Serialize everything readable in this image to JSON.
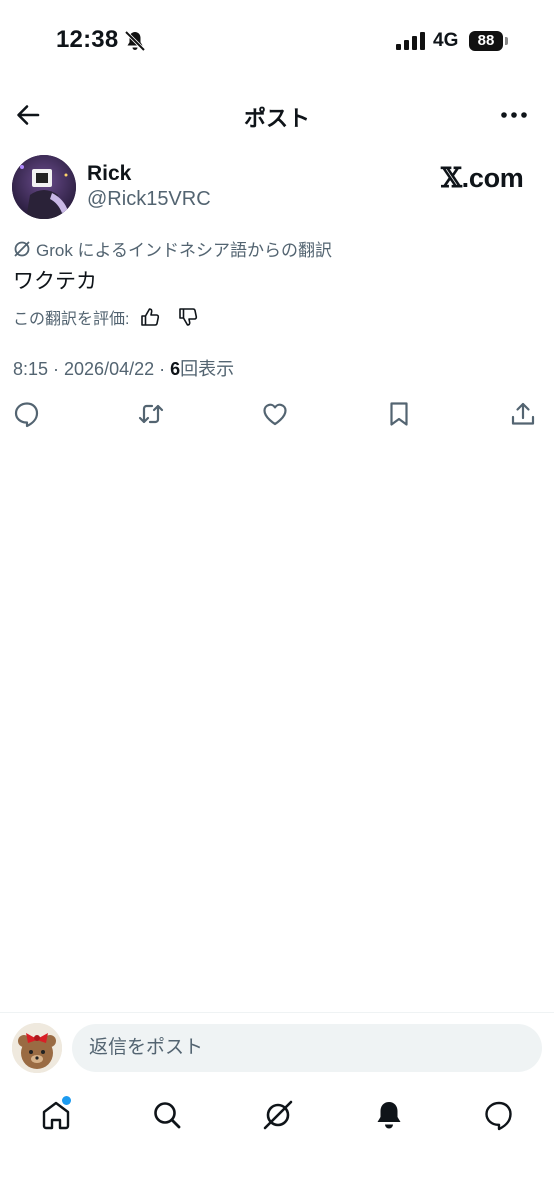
{
  "status_bar": {
    "time": "12:38",
    "network": "4G",
    "battery": "88"
  },
  "header": {
    "title": "ポスト"
  },
  "post": {
    "display_name": "Rick",
    "handle": "@Rick15VRC",
    "brand": {
      "x_letter": "𝕏",
      "suffix": ".com"
    },
    "translated_from": "Grok によるインドネシア語からの翻訳",
    "text": "ワクテカ",
    "rate_label": "この翻訳を評価:",
    "timestamp": "8:15 · 2026/04/22 · ",
    "views_count": "6",
    "views_label": "回表示"
  },
  "reply": {
    "placeholder": "返信をポスト"
  },
  "icons": {
    "back": "back-arrow-icon",
    "more": "more-icon",
    "reply": "reply-icon",
    "repost": "repost-icon",
    "like": "heart-icon",
    "bookmark": "bookmark-icon",
    "share": "share-icon",
    "home": "home-icon",
    "search": "search-icon",
    "grok": "grok-icon",
    "notifications": "bell-icon",
    "messages": "message-icon"
  },
  "colors": {
    "accent": "#1d9bf0",
    "text": "#0f1419",
    "secondary": "#536471"
  }
}
